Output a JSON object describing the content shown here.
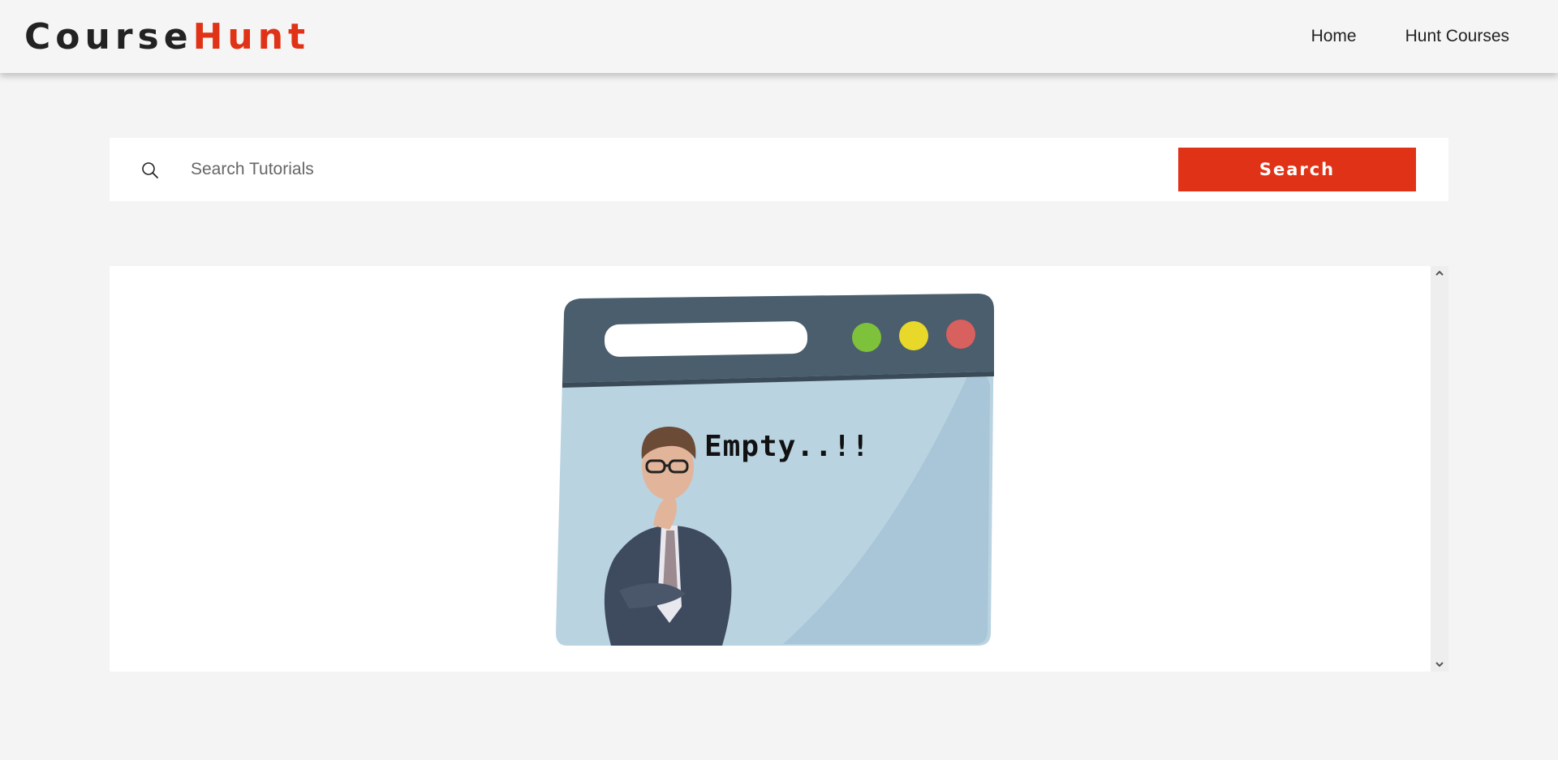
{
  "app": {
    "logo_part1": "Course",
    "logo_part2": "Hunt"
  },
  "nav": {
    "home": "Home",
    "hunt_courses": "Hunt Courses"
  },
  "search": {
    "placeholder": "Search Tutorials",
    "value": "",
    "button_label": "Search",
    "icon": "search-icon"
  },
  "results": {
    "empty_message": "Empty..!!",
    "illustration": "empty-browser-illustration"
  },
  "colors": {
    "accent": "#e03216",
    "background": "#f4f4f4",
    "panel": "#ffffff",
    "browser_frame": "#4a5e6d",
    "browser_body": "#b9d3e1",
    "dot_green": "#7ec13a",
    "dot_yellow": "#e8d82a",
    "dot_red": "#d8605e"
  }
}
